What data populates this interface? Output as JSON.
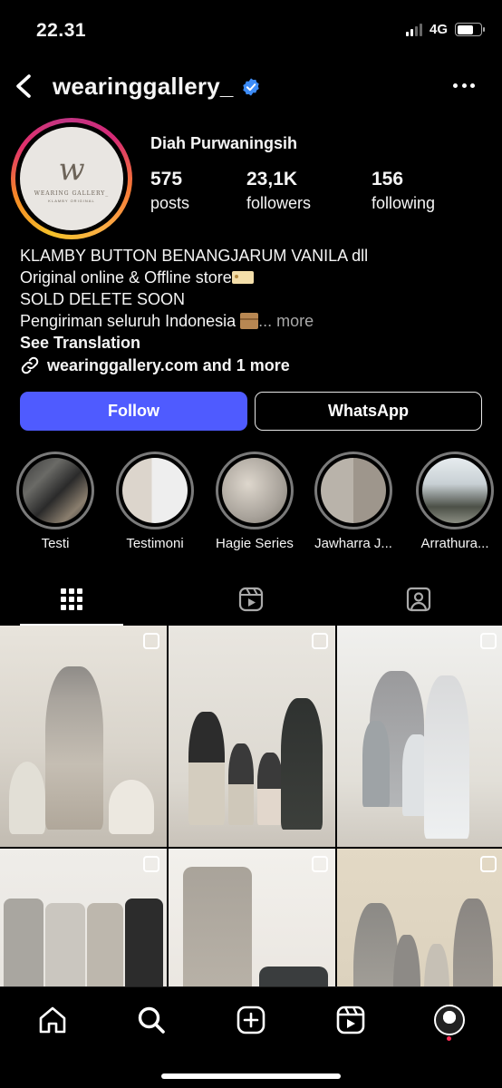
{
  "status_bar": {
    "time": "22.31",
    "network": "4G"
  },
  "header": {
    "username": "wearinggallery_"
  },
  "avatar": {
    "monogram": "w",
    "brand_text": "WEARING GALLERY_",
    "sub_text": "KLAMBY ORIGINAL"
  },
  "profile": {
    "display_name": "Diah Purwaningsih",
    "stats": [
      {
        "value": "575",
        "label": "posts"
      },
      {
        "value": "23,1K",
        "label": "followers"
      },
      {
        "value": "156",
        "label": "following"
      }
    ],
    "bio": {
      "line1": "KLAMBY BUTTON BENANGJARUM VANILA dll",
      "line2": "Original online & Offline store",
      "line3": "SOLD DELETE SOON",
      "line4": "Pengiriman seluruh Indonesia",
      "more": "... more",
      "see_translation": "See Translation"
    },
    "link_text": "wearinggallery.com and 1 more"
  },
  "buttons": {
    "follow": "Follow",
    "whatsapp": "WhatsApp"
  },
  "highlights": [
    {
      "label": "Testi"
    },
    {
      "label": "Testimoni"
    },
    {
      "label": "Hagie Series"
    },
    {
      "label": "Jawharra J..."
    },
    {
      "label": "Arrathura..."
    }
  ],
  "tabs": [
    "grid-icon",
    "reels-icon",
    "tagged-icon"
  ],
  "bottom_nav": [
    "home-icon",
    "search-icon",
    "create-icon",
    "reels-icon",
    "profile-avatar"
  ]
}
